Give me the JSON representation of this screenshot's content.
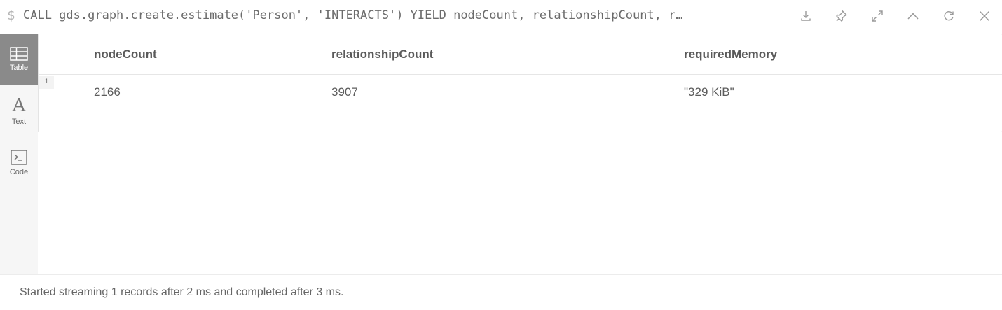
{
  "header": {
    "prompt_symbol": "$",
    "query": "CALL gds.graph.create.estimate('Person', 'INTERACTS') YIELD nodeCount, relationshipCount, r…",
    "toolbar": [
      {
        "icon": "download-icon"
      },
      {
        "icon": "pin-icon"
      },
      {
        "icon": "expand-icon"
      },
      {
        "icon": "collapse-up-icon"
      },
      {
        "icon": "rerun-icon"
      },
      {
        "icon": "close-icon"
      }
    ]
  },
  "sidenav": {
    "items": [
      {
        "label": "Table",
        "icon": "table-icon",
        "active": true
      },
      {
        "label": "Text",
        "icon": "text-icon",
        "active": false
      },
      {
        "label": "Code",
        "icon": "code-icon",
        "active": false
      }
    ]
  },
  "table": {
    "columns": [
      "nodeCount",
      "relationshipCount",
      "requiredMemory"
    ],
    "rows": [
      {
        "index": "1",
        "cells": [
          "2166",
          "3907",
          "\"329 KiB\""
        ]
      }
    ]
  },
  "footer": {
    "status": "Started streaming 1 records after 2 ms and completed after 3 ms."
  },
  "colors": {
    "active_nav": "#8a8a8a",
    "nav_bg": "#f6f6f6",
    "text": "#555555"
  }
}
